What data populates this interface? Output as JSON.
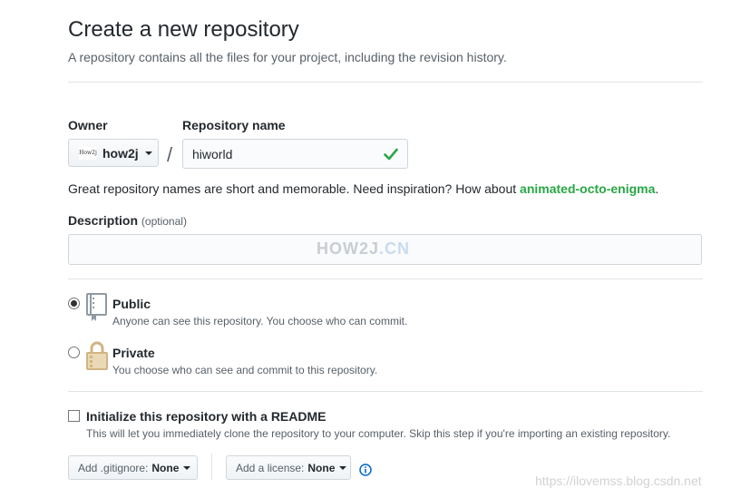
{
  "header": {
    "title": "Create a new repository",
    "subtitle": "A repository contains all the files for your project, including the revision history."
  },
  "owner": {
    "label": "Owner",
    "avatar_text": "How2j",
    "value": "how2j"
  },
  "separator": "/",
  "repo_name": {
    "label": "Repository name",
    "value": "hiworld"
  },
  "hint": {
    "text": "Great repository names are short and memorable. Need inspiration? How about ",
    "suggestion": "animated-octo-enigma",
    "end": "."
  },
  "description": {
    "label": "Description",
    "optional": "(optional)",
    "value": ""
  },
  "watermark": {
    "main": "HOW2J",
    "accent": ".CN"
  },
  "visibility": {
    "public": {
      "title": "Public",
      "description": "Anyone can see this repository. You choose who can commit.",
      "checked": true
    },
    "private": {
      "title": "Private",
      "description": "You choose who can see and commit to this repository.",
      "checked": false
    }
  },
  "readme": {
    "title": "Initialize this repository with a README",
    "description": "This will let you immediately clone the repository to your computer. Skip this step if you're importing an existing repository.",
    "checked": false
  },
  "gitignore": {
    "label": "Add .gitignore:",
    "value": "None"
  },
  "license": {
    "label": "Add a license:",
    "value": "None"
  },
  "icons": {
    "valid": "check-icon",
    "public": "repo-book-icon",
    "private": "lock-icon",
    "info": "info-icon"
  },
  "colors": {
    "success": "#28a745",
    "info": "#0366d6",
    "lock": "#d1b482"
  },
  "source_watermark": "https://ilovemss.blog.csdn.net"
}
